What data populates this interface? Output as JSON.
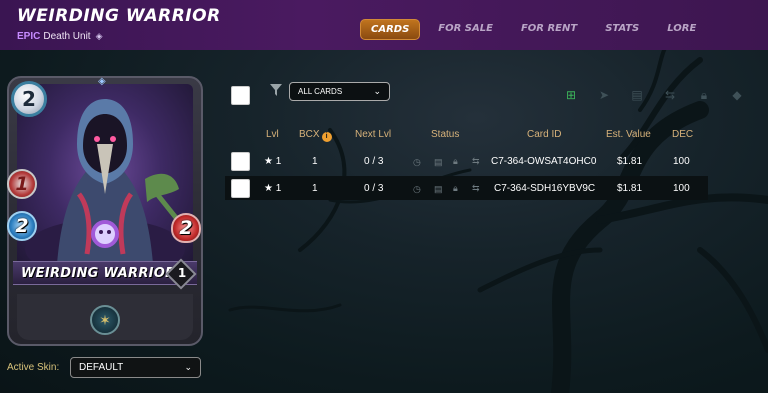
{
  "header": {
    "title": "WEIRDING WARRIOR",
    "rarity": "EPIC",
    "subtitle": "Death Unit",
    "tabs": [
      {
        "label": "CARDS",
        "active": true
      },
      {
        "label": "FOR SALE",
        "active": false
      },
      {
        "label": "FOR RENT",
        "active": false
      },
      {
        "label": "STATS",
        "active": false
      },
      {
        "label": "LORE",
        "active": false
      }
    ]
  },
  "card": {
    "mana": "2",
    "melee": "1",
    "magic": "2",
    "health": "2",
    "name": "WEIRDING WARRIOR",
    "level": "1",
    "icons": [
      "diamond-icon",
      "skull-icon",
      "ability-icon"
    ]
  },
  "skin": {
    "label": "Active Skin:",
    "value": "DEFAULT"
  },
  "toolbar": {
    "filter_value": "ALL CARDS",
    "icons": [
      "add-card-icon",
      "send-icon",
      "sell-icon",
      "rent-icon",
      "lock-icon",
      "burn-icon"
    ]
  },
  "table": {
    "headers": [
      "Lvl",
      "BCX",
      "Next Lvl",
      "Status",
      "Card ID",
      "Est. Value",
      "DEC"
    ],
    "rows": [
      {
        "lvl": "★ 1",
        "bcx": "1",
        "next": "0 / 3",
        "card_id": "C7-364-OWSAT4OHC0",
        "value": "$1.81",
        "dec": "100"
      },
      {
        "lvl": "★ 1",
        "bcx": "1",
        "next": "0 / 3",
        "card_id": "C7-364-SDH16YBV9C",
        "value": "$1.81",
        "dec": "100"
      }
    ]
  },
  "colors": {
    "accent": "#c0741e",
    "header_bg": "#3a1552",
    "rarity": "#c78bff",
    "table_header": "#d7b27a"
  }
}
